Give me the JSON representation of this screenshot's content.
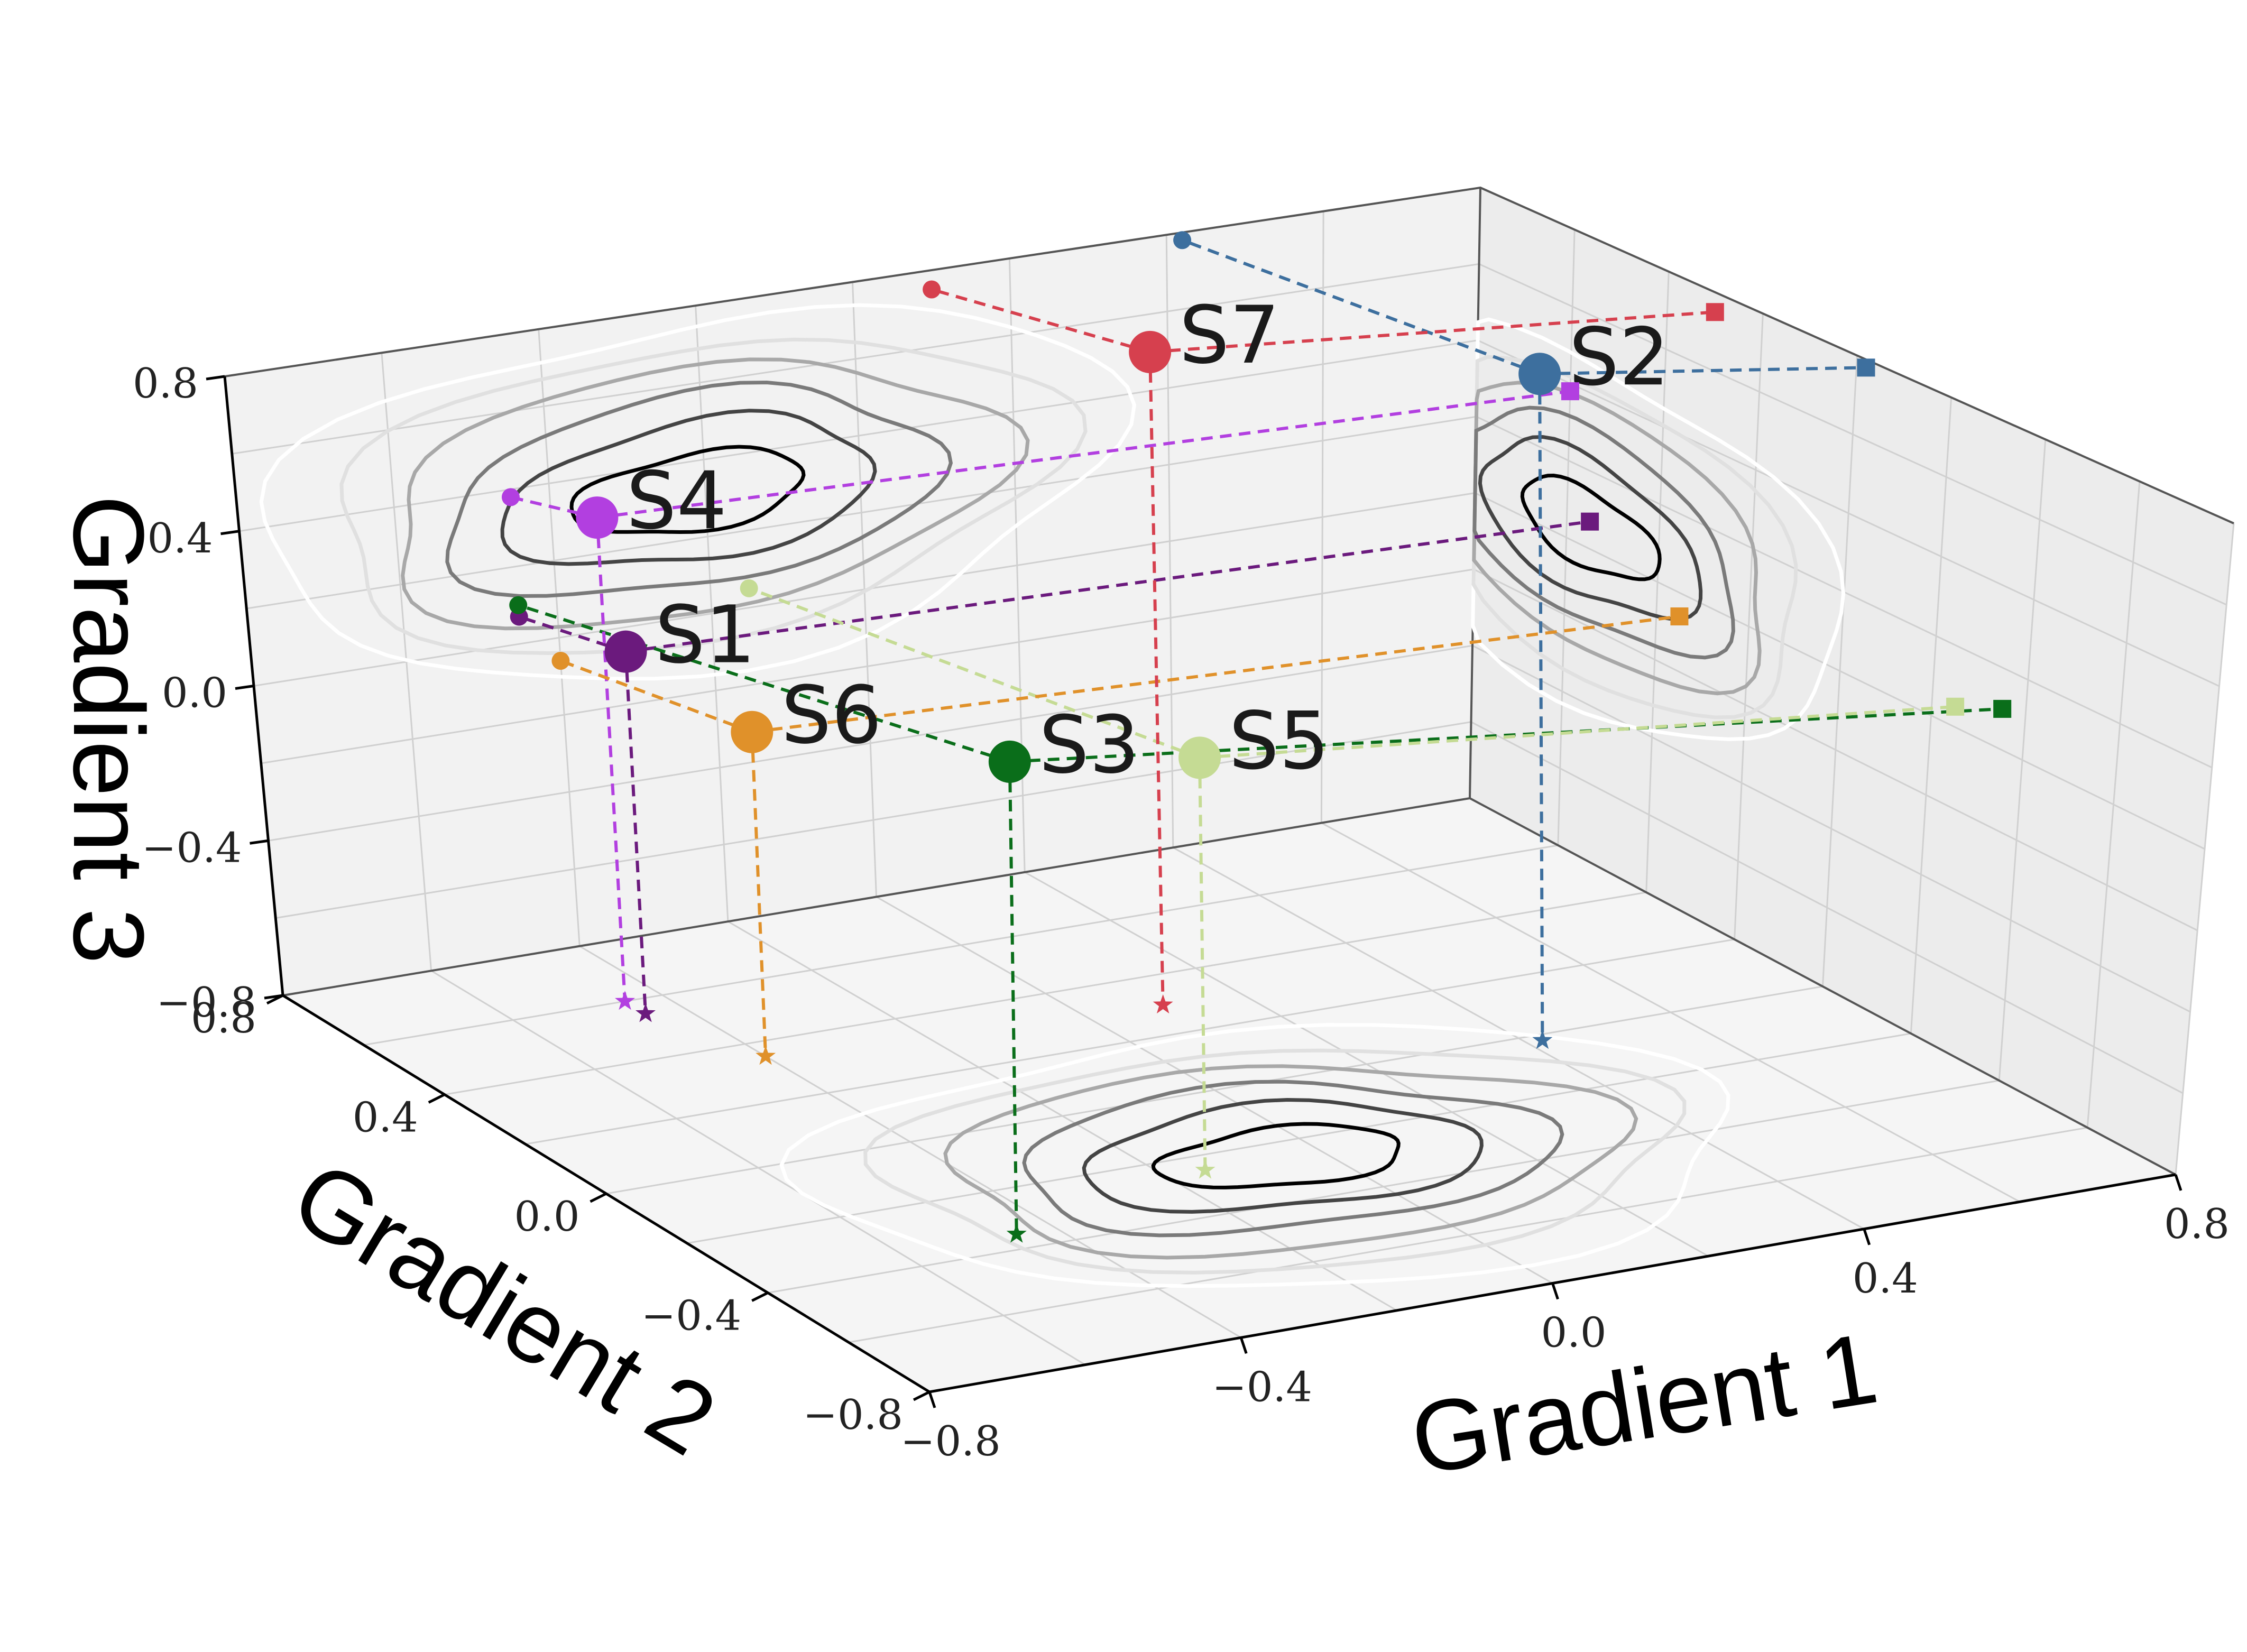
{
  "chart_data": {
    "type": "scatter",
    "dimensions": 3,
    "axes": {
      "x": {
        "label": "Gradient 1",
        "range": [
          -0.8,
          0.8
        ],
        "ticks": [
          -0.8,
          -0.4,
          0.0,
          0.4,
          0.8
        ],
        "tick_labels": [
          "−0.8",
          "−0.4",
          "0.0",
          "0.4",
          "0.8"
        ]
      },
      "y": {
        "label": "Gradient 2",
        "range": [
          -0.8,
          0.8
        ],
        "ticks": [
          -0.8,
          -0.4,
          0.0,
          0.4,
          0.8
        ],
        "tick_labels": [
          "−0.8",
          "−0.4",
          "0.0",
          "0.4",
          "0.8"
        ]
      },
      "z": {
        "label": "Gradient 3",
        "range": [
          -0.8,
          0.8
        ],
        "ticks": [
          -0.8,
          -0.4,
          0.0,
          0.4,
          0.8
        ],
        "tick_labels": [
          "−0.8",
          "−0.4",
          "0.0",
          "0.4",
          "0.8"
        ]
      }
    },
    "grid": true,
    "projections": "dashed drop lines to the back walls (circle, square) and floor (star)",
    "density_contours": [
      {
        "plane": "back wall (Gradient 1 – Gradient 3)",
        "center": [
          -0.22,
          0.32
        ],
        "colors": [
          "#ffffff",
          "#e0e0e0",
          "#a8a8a8",
          "#7a7a7a",
          "#444444",
          "#000000"
        ]
      },
      {
        "plane": "side wall (Gradient 2 – Gradient 3)",
        "center": [
          0.55,
          0.05
        ],
        "colors": [
          "#ffffff",
          "#e0e0e0",
          "#a8a8a8",
          "#7a7a7a",
          "#444444",
          "#000000"
        ]
      },
      {
        "plane": "floor (Gradient 1 – Gradient 2)",
        "center": [
          -0.05,
          -0.25
        ],
        "colors": [
          "#ffffff",
          "#e0e0e0",
          "#a8a8a8",
          "#7a7a7a",
          "#444444",
          "#000000"
        ]
      }
    ],
    "points": [
      {
        "label": "S1",
        "x": -0.45,
        "y": 0.55,
        "z": 0.07,
        "color": "#6b1a7d"
      },
      {
        "label": "S2",
        "x": 0.42,
        "y": -0.02,
        "z": 0.78,
        "color": "#3d6f9e"
      },
      {
        "label": "S3",
        "x": -0.45,
        "y": -0.35,
        "z": 0.1,
        "color": "#0a6e1a"
      },
      {
        "label": "S4",
        "x": -0.45,
        "y": 0.6,
        "z": 0.38,
        "color": "#b23fe0"
      },
      {
        "label": "S5",
        "x": -0.15,
        "y": -0.25,
        "z": 0.05,
        "color": "#c5db94"
      },
      {
        "label": "S6",
        "x": -0.4,
        "y": 0.35,
        "z": -0.06,
        "color": "#e0912a"
      },
      {
        "label": "S7",
        "x": 0.1,
        "y": 0.3,
        "z": 0.75,
        "color": "#d6404e"
      }
    ]
  }
}
